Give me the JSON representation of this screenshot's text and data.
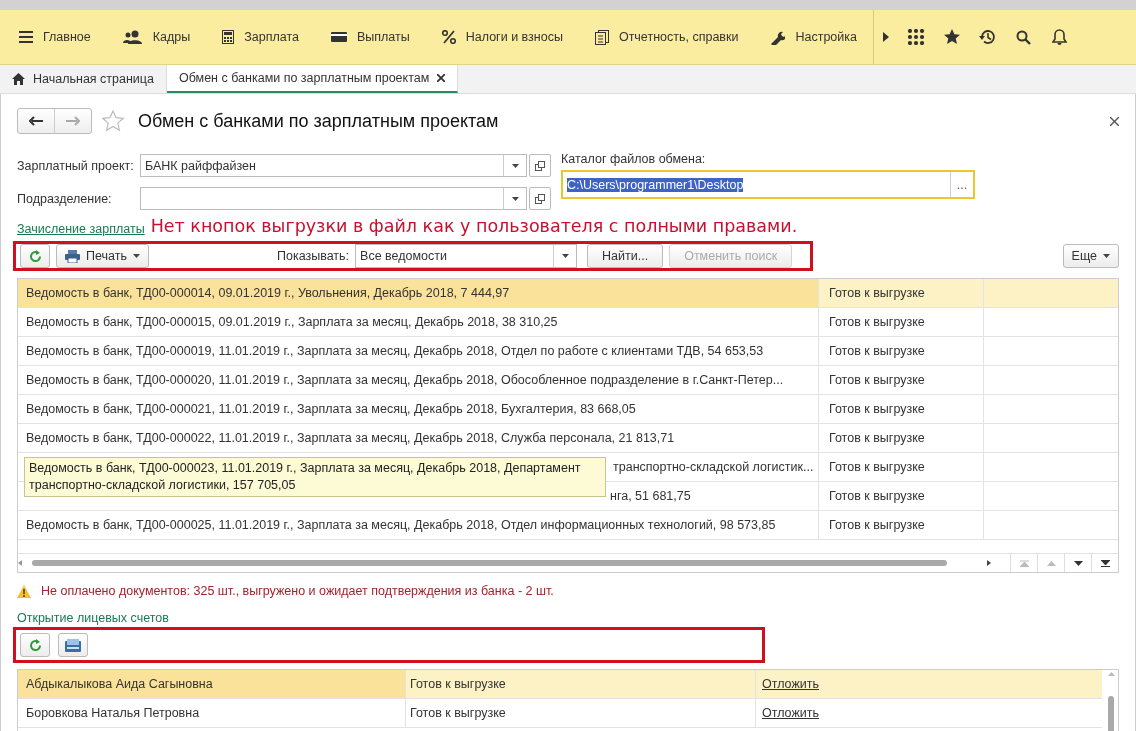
{
  "sections": [
    {
      "label": "Главное"
    },
    {
      "label": "Кадры"
    },
    {
      "label": "Зарплата"
    },
    {
      "label": "Выплаты"
    },
    {
      "label": "Налоги и взносы"
    },
    {
      "label": "Отчетность, справки"
    },
    {
      "label": "Настройка"
    }
  ],
  "tabs": [
    {
      "label": "Начальная страница",
      "selected": false
    },
    {
      "label": "Обмен с банками по зарплатным проектам",
      "selected": true
    }
  ],
  "form": {
    "title": "Обмен с банками по зарплатным проектам",
    "fields": [
      {
        "label": "Зарплатный проект:",
        "value": "БАНК райффайзен"
      },
      {
        "label": "Подразделение:"
      }
    ],
    "catalog": {
      "label": "Каталог файлов обмена:",
      "value": "C:\\Users\\programmer1\\Desktop",
      "button": "..."
    }
  },
  "annotation": "Нет кнопок выгрузки в файл как у пользователя с полными правами.",
  "payroll": {
    "link": "Зачисление зарплаты",
    "toolbar": {
      "print": "Печать",
      "show_label": "Показывать:",
      "show_value": "Все ведомости",
      "find": "Найти...",
      "cancel": "Отменить поиск",
      "cancel_disabled": true,
      "more": "Еще"
    },
    "rows": [
      {
        "kind": "full",
        "text": "Ведомость в банк, ТД00-000014, 09.01.2019 г., Увольнения, Декабрь 2018, 7 444,97",
        "status": "Готов к выгрузке",
        "selected": true
      },
      {
        "kind": "full",
        "text": "Ведомость в банк, ТД00-000015, 09.01.2019 г., Зарплата за месяц, Декабрь 2018, 38 310,25",
        "status": "Готов к выгрузке",
        "selected": false
      },
      {
        "kind": "full",
        "text": "Ведомость в банк, ТД00-000019, 11.01.2019 г., Зарплата за месяц, Декабрь 2018, Отдел по работе с клиентами ТДВ, 54 653,53",
        "status": "Готов к выгрузке",
        "selected": false
      },
      {
        "kind": "full",
        "text": "Ведомость в банк, ТД00-000020, 11.01.2019 г., Зарплата за месяц, Декабрь 2018, Обособленное подразделение в г.Санкт-Петер...",
        "status": "Готов к выгрузке",
        "selected": false
      },
      {
        "kind": "full",
        "text": "Ведомость в банк, ТД00-000021, 11.01.2019 г., Зарплата за месяц, Декабрь 2018, Бухгалтерия, 83 668,05",
        "status": "Готов к выгрузке",
        "selected": false
      },
      {
        "kind": "full",
        "text": "Ведомость в банк, ТД00-000022, 11.01.2019 г., Зарплата за месяц, Декабрь 2018, Служба персонала, 21 813,71",
        "status": "Готов к выгрузке",
        "selected": false
      },
      {
        "kind": "covered",
        "text": "транспортно-складской логистик...",
        "status": "Готов к выгрузке",
        "selected": false
      },
      {
        "kind": "partly",
        "text": "нга, 51 681,75",
        "status": "Готов к выгрузке",
        "selected": false
      },
      {
        "kind": "full",
        "text": "Ведомость в банк, ТД00-000025, 11.01.2019 г., Зарплата за месяц, Декабрь 2018, Отдел информационных технологий, 98 573,85",
        "status": "Готов к выгрузке",
        "selected": false
      }
    ],
    "tooltip": "Ведомость в банк, ТД00-000023, 11.01.2019 г., Зарплата за месяц, Декабрь 2018, Департамент транспортно-складской логистики, 157 705,05"
  },
  "warning": "Не оплачено документов: 325 шт., выгружено и ожидает подтверждения из банка - 2 шт.",
  "accounts": {
    "link": "Открытие лицевых счетов",
    "rows": [
      {
        "name": "Абдыкалыкова Аида Сагыновна",
        "status": "Готов к выгрузке",
        "action": "Отложить",
        "selected": true
      },
      {
        "name": "Боровкова Наталья Петровна",
        "status": "Готов к выгрузке",
        "action": "Отложить",
        "selected": false
      }
    ]
  }
}
